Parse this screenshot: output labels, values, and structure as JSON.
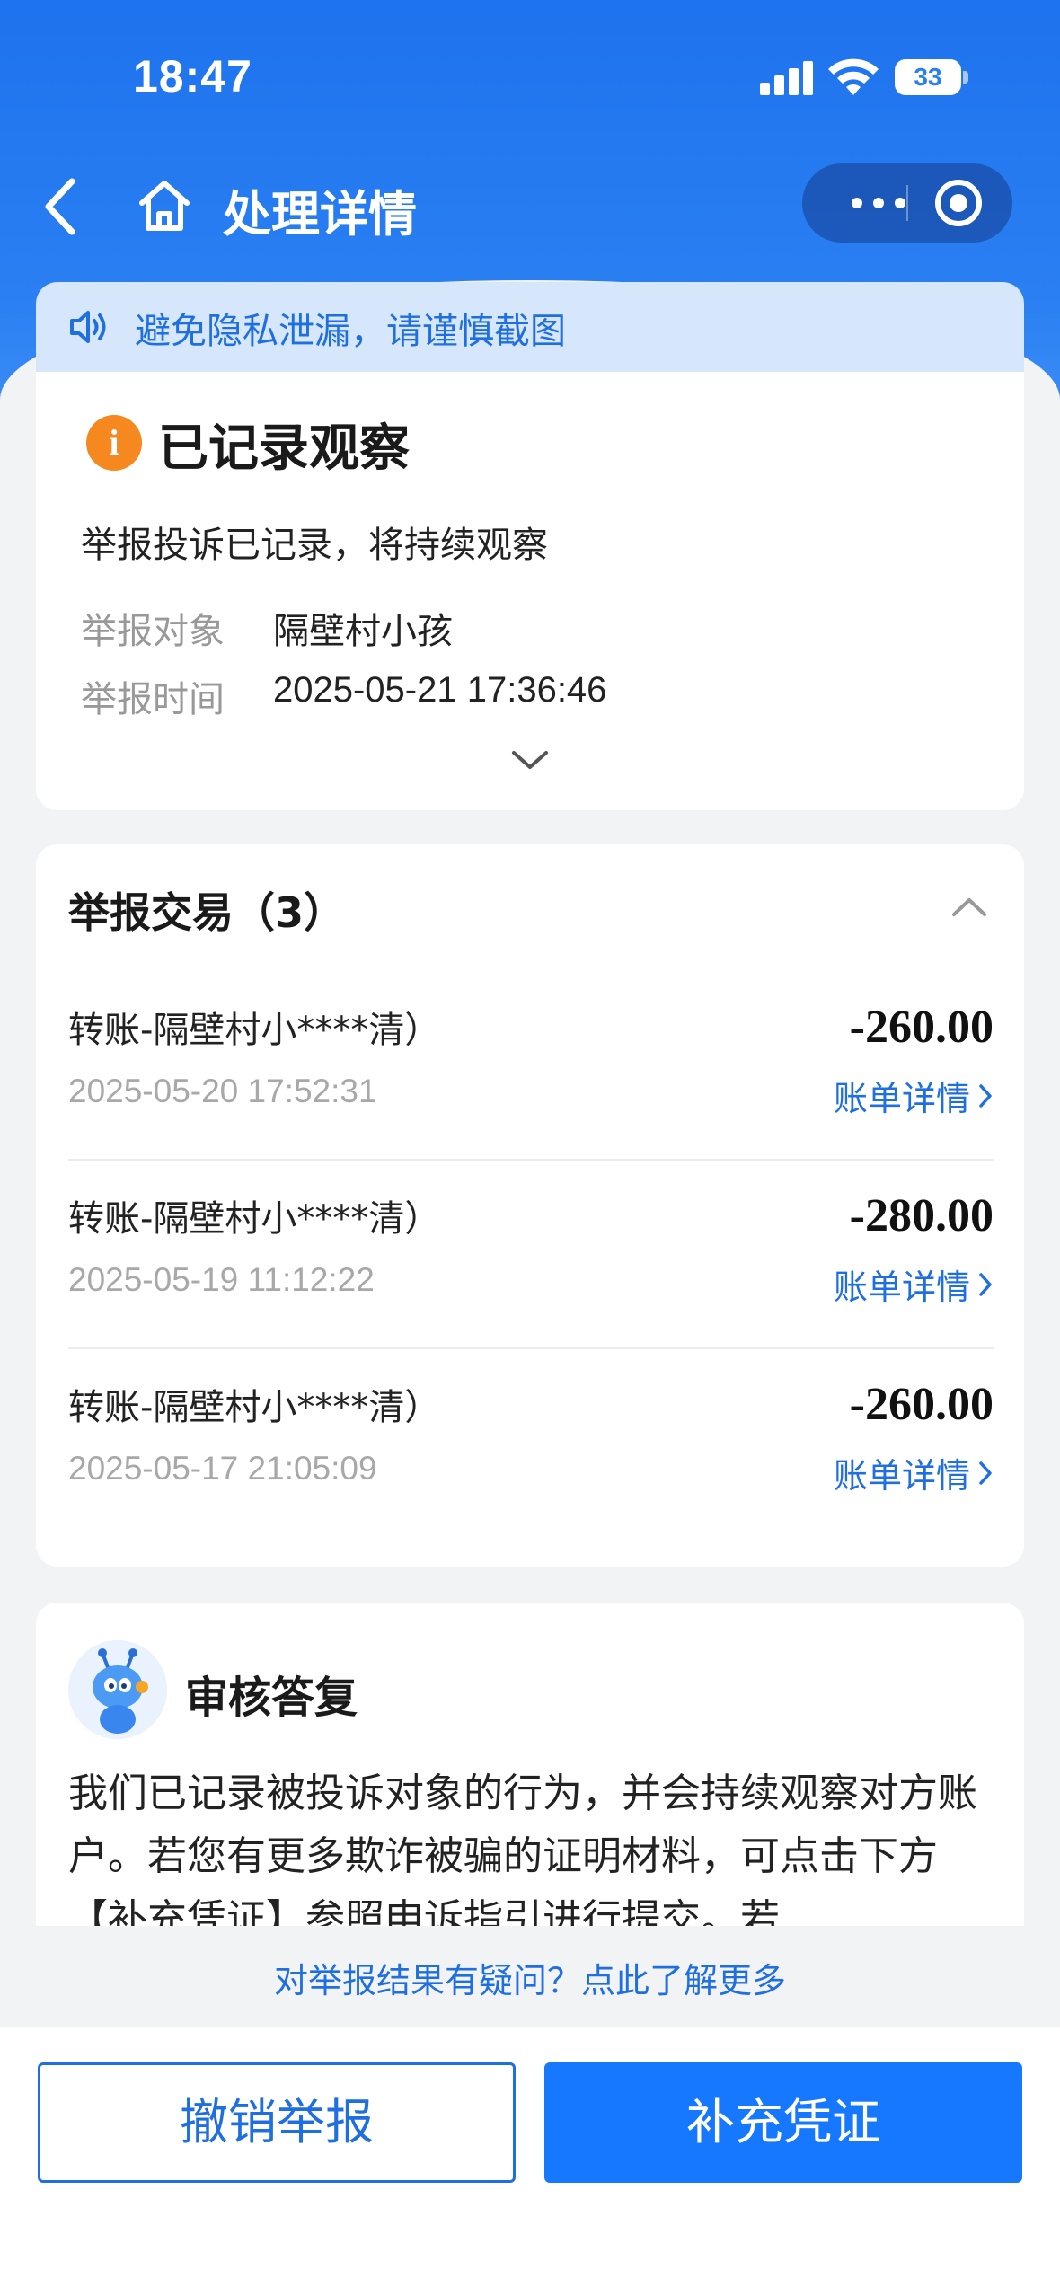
{
  "status_bar": {
    "time": "18:47",
    "battery": "33"
  },
  "nav": {
    "title": "处理详情"
  },
  "notice": {
    "text": "避免隐私泄漏，请谨慎截图"
  },
  "status_card": {
    "title": "已记录观察",
    "description": "举报投诉已记录，将持续观察",
    "rows": [
      {
        "label": "举报对象",
        "value": "隔壁村小孩"
      },
      {
        "label": "举报时间",
        "value": "2025-05-21 17:36:46"
      }
    ]
  },
  "transactions": {
    "title": "举报交易（3）",
    "items": [
      {
        "name": "转账-隔壁村小****清）",
        "amount": "-260.00",
        "date": "2025-05-20 17:52:31",
        "detail_label": "账单详情"
      },
      {
        "name": "转账-隔壁村小****清）",
        "amount": "-280.00",
        "date": "2025-05-19 11:12:22",
        "detail_label": "账单详情"
      },
      {
        "name": "转账-隔壁村小****清）",
        "amount": "-260.00",
        "date": "2025-05-17 21:05:09",
        "detail_label": "账单详情"
      }
    ]
  },
  "reply": {
    "title": "审核答复",
    "body": "我们已记录被投诉对象的行为，并会持续观察对方账户。若您有更多欺诈被骗的证明材料，可点击下方【补充凭证】参照申诉指引进行提交。若"
  },
  "help_link": "对举报结果有疑问？点此了解更多",
  "buttons": {
    "cancel": "撤销举报",
    "supplement": "补充凭证"
  },
  "colors": {
    "primary": "#1677ff",
    "link": "#1f6fe0",
    "warning": "#f5891f"
  }
}
